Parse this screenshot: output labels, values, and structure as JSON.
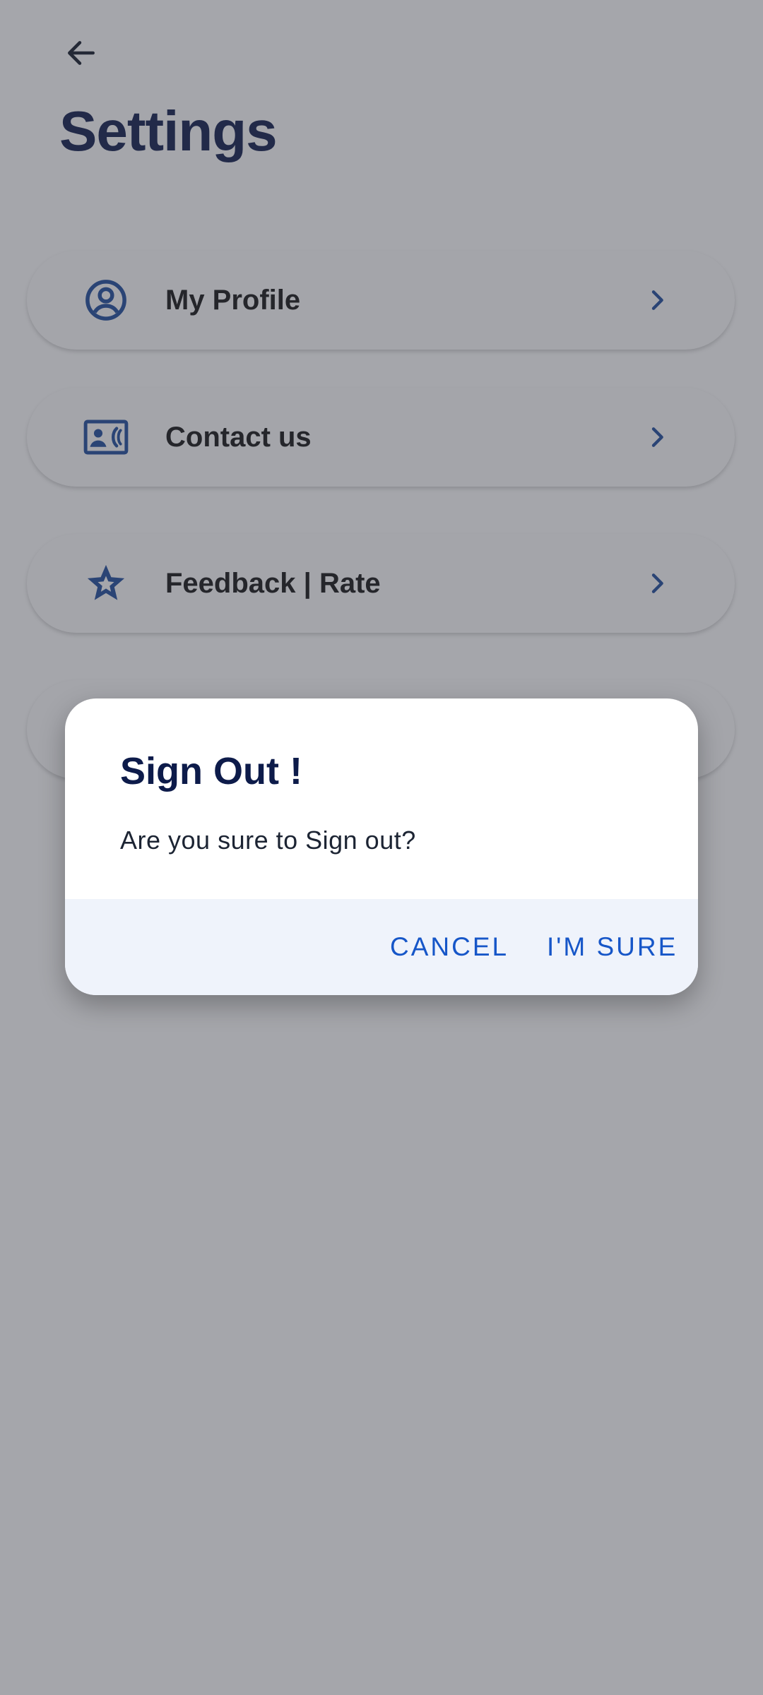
{
  "header": {
    "back_icon": "arrow-left-icon",
    "title": "Settings"
  },
  "menu": {
    "items": [
      {
        "label": "My Profile",
        "icon": "account-circle-icon"
      },
      {
        "label": "Contact us",
        "icon": "contact-phone-icon"
      },
      {
        "label": "Feedback | Rate",
        "icon": "star-icon"
      },
      {
        "label": "",
        "icon": ""
      }
    ]
  },
  "dialog": {
    "title": "Sign Out !",
    "message": "Are you sure to Sign out?",
    "cancel_label": "CANCEL",
    "confirm_label": "I'M SURE"
  },
  "colors": {
    "title": "#0d1b4a",
    "icon": "#1d4a9c",
    "action": "#1656c8",
    "dialog_footer": "#eff3fb",
    "scrim": "#a4a6aa"
  }
}
